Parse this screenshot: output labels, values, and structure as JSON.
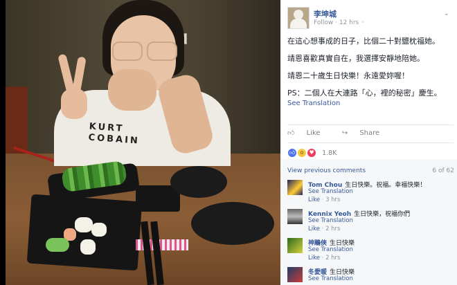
{
  "post": {
    "author": "李坤城",
    "follow_label": "Follow",
    "time": "12 hrs",
    "lines": [
      "在這心想事成的日子，比個二十對鹽枕福她。",
      "靖恩喜歡真實自在，我選擇安靜地陪她。",
      "靖恩二十歲生日快樂！永遠愛妳喔！",
      "PS：二個人在大連路「心，裡的秘密」慶生。"
    ],
    "see_translation": "See Translation"
  },
  "actions": {
    "like": "Like",
    "share": "Share"
  },
  "reactions": {
    "count": "1.8K",
    "types": [
      "like-icon",
      "wow-icon",
      "love-icon"
    ]
  },
  "comments": {
    "view_previous": "View previous comments",
    "pager": "6 of 62",
    "see_translation": "See Translation",
    "like_label": "Like",
    "items": [
      {
        "name": "Tom Chou",
        "text": "生日快樂。祝福。幸福快樂！",
        "time": "3 hrs"
      },
      {
        "name": "Kennix Yeoh",
        "text": "生日快樂，祝福你們",
        "time": "2 hrs"
      },
      {
        "name": "神鵰俠",
        "text": "生日快樂",
        "time": "2 hrs"
      },
      {
        "name": "冬愛暖",
        "text": "生日快樂",
        "time": ""
      }
    ]
  },
  "photo": {
    "shirt_text": "KURT COBAIN"
  },
  "colors": {
    "link": "#365899",
    "text": "#1d2129",
    "muted": "#90949c",
    "like_blue": "#4e72ea",
    "love_red": "#ef3d5a",
    "wow_yellow": "#f6c945"
  }
}
